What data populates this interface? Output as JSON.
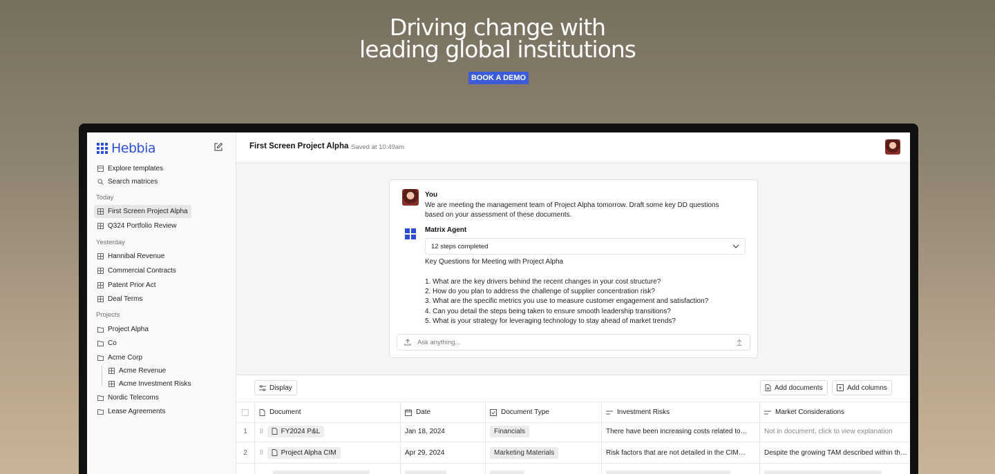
{
  "hero": {
    "title_line1": "Driving change with",
    "title_line2": "leading global institutions",
    "cta_label": "BOOK A DEMO"
  },
  "colors": {
    "brand": "#2d4fd6",
    "cta": "#3b5bdb"
  },
  "app": {
    "logo_text": "Hebbia",
    "sidebar": {
      "actions": [
        {
          "label": "Explore templates",
          "icon": "template-icon"
        },
        {
          "label": "Search matrices",
          "icon": "search-icon"
        }
      ],
      "today_label": "Today",
      "today": [
        {
          "label": "First Screen Project Alpha",
          "active": true
        },
        {
          "label": "Q324 Portfolio Review"
        }
      ],
      "yesterday_label": "Yesterday",
      "yesterday": [
        {
          "label": "Hannibal Revenue"
        },
        {
          "label": "Commercial Contracts"
        },
        {
          "label": "Patent Prior Act"
        },
        {
          "label": "Deal Terms"
        }
      ],
      "projects_label": "Projects",
      "projects": [
        {
          "label": "Project Alpha"
        },
        {
          "label": "Co"
        },
        {
          "label": "Acme Corp"
        },
        {
          "label": "Acme Revenue"
        },
        {
          "label": "Acme Investment Risks"
        },
        {
          "label": "Nordic Telecoms"
        },
        {
          "label": "Lease Agreements"
        }
      ]
    },
    "header": {
      "title": "First Screen Project Alpha",
      "saved": "Saved at 10:49am"
    },
    "chat": {
      "user_name": "You",
      "user_message": "We are meeting the management team of Project Alpha tomorrow. Draft some key DD questions based on your assessment of these documents.",
      "agent_name": "Matrix Agent",
      "steps": "12 steps completed",
      "answer_title": "Key Questions for Meeting with Project Alpha",
      "questions": [
        "1. What are the key drivers behind the recent changes in your cost structure?",
        "2. How do you plan to address the challenge of supplier concentration risk?",
        "3. What are the specific metrics you use to measure customer engagement and satisfaction?",
        "4. Can you detail the steps being taken to ensure smooth leadership transitions?",
        "5. What is your strategy for leveraging technology to stay ahead of market trends?"
      ],
      "input_placeholder": "Ask anything..."
    },
    "toolbar": {
      "display": "Display",
      "add_documents": "Add documents",
      "add_columns": "Add columns"
    },
    "table": {
      "columns": [
        "Document",
        "Date",
        "Document Type",
        "Investment Risks",
        "Market Considerations"
      ],
      "rows": [
        {
          "num": "1",
          "document": "FY2024 P&L",
          "date": "Jan 18, 2024",
          "type": "Financials",
          "risks": "There have been increasing costs related to…",
          "market": "Not in document, click to view explanation"
        },
        {
          "num": "2",
          "document": "Project Alpha CIM",
          "date": "Apr 29, 2024",
          "type": "Marketing Materials",
          "risks": "Risk factors that are not detailed in the CIM…",
          "market": "Despite the growing TAM described within th…"
        }
      ]
    }
  }
}
